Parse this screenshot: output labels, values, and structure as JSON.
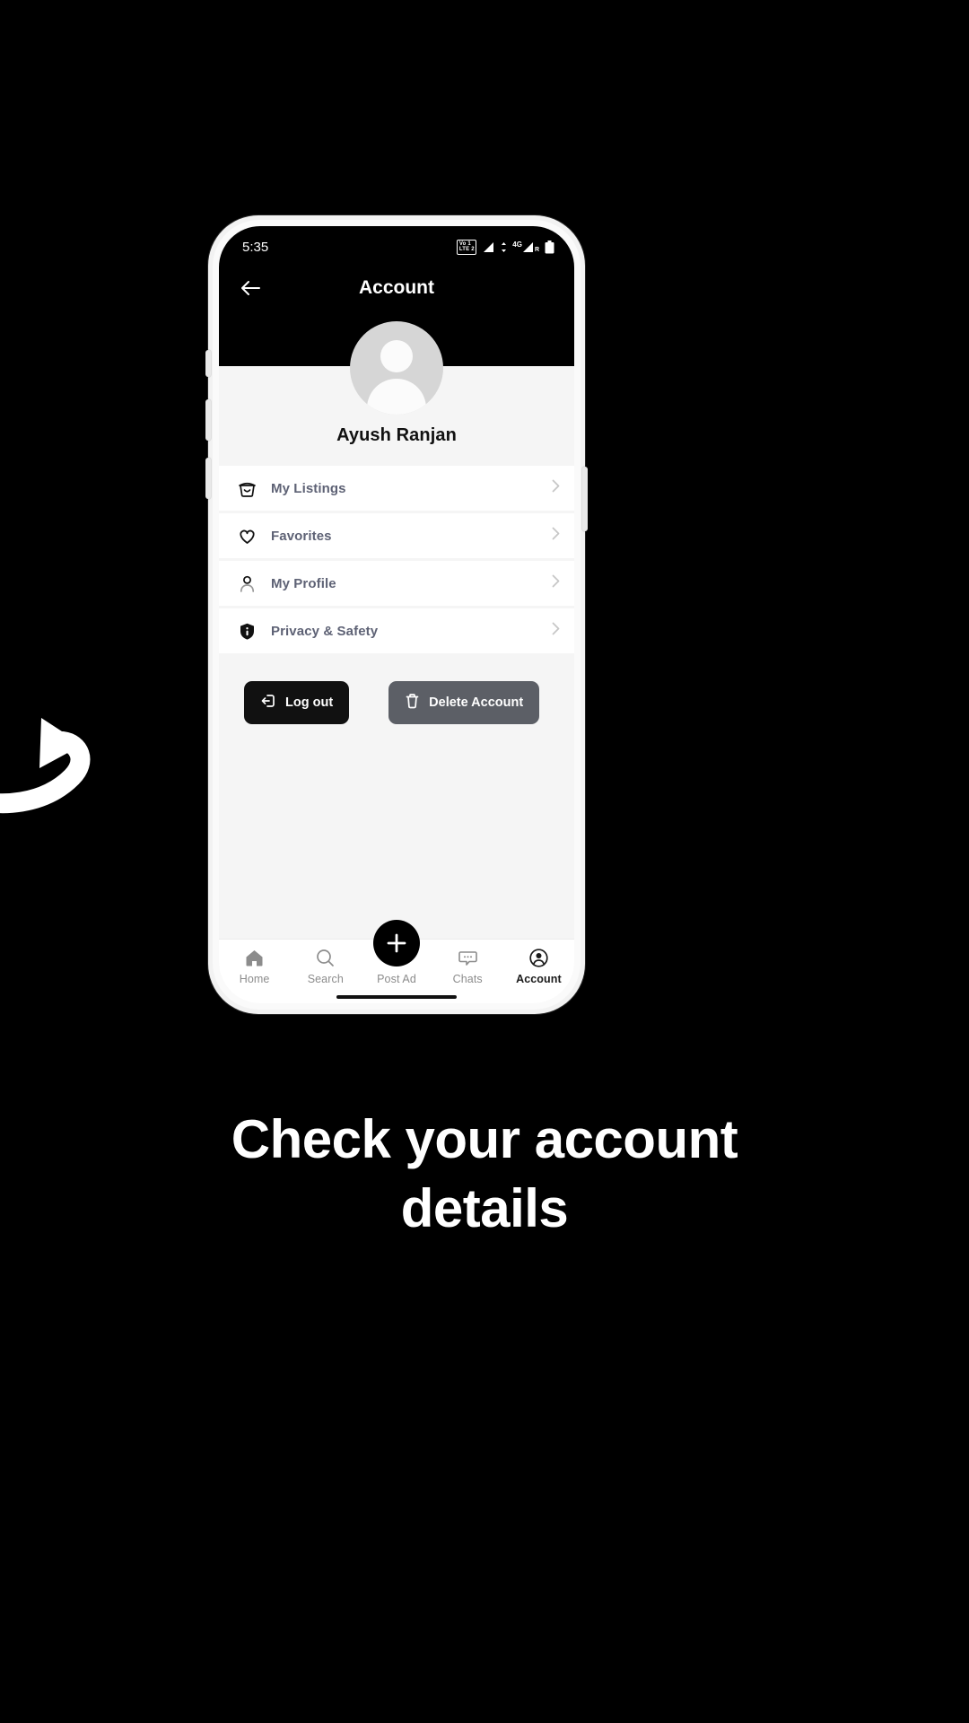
{
  "promo": {
    "headline_line1": "Check your account",
    "headline_line2": "details",
    "background_color": "#000000",
    "arrow_icon": "curved-arrow-icon"
  },
  "phone": {
    "status_bar": {
      "time": "5:35",
      "volte_top": "Vo 1",
      "volte_bottom": "LTE 2",
      "network_type": "4G",
      "roaming": "R",
      "icons": [
        "volte-icon",
        "signal-bars-icon",
        "data-arrows-icon",
        "signal-4g-icon",
        "battery-icon"
      ]
    },
    "app_bar": {
      "back_icon": "back-arrow-icon",
      "title": "Account"
    },
    "profile": {
      "avatar_icon": "avatar-placeholder-icon",
      "name": "Ayush Ranjan"
    },
    "menu": {
      "items": [
        {
          "label": "My Listings",
          "icon": "basket-icon",
          "chevron": "chevron-right-icon"
        },
        {
          "label": "Favorites",
          "icon": "heart-icon",
          "chevron": "chevron-right-icon"
        },
        {
          "label": "My Profile",
          "icon": "person-icon",
          "chevron": "chevron-right-icon"
        },
        {
          "label": "Privacy & Safety",
          "icon": "shield-info-icon",
          "chevron": "chevron-right-icon"
        }
      ]
    },
    "actions": {
      "logout_label": "Log out",
      "logout_icon": "logout-icon",
      "logout_color": "#111111",
      "delete_label": "Delete Account",
      "delete_icon": "trash-icon",
      "delete_color": "#5c5f66"
    },
    "bottom_nav": {
      "items": [
        {
          "label": "Home",
          "icon": "home-icon",
          "active": false
        },
        {
          "label": "Search",
          "icon": "search-icon",
          "active": false
        },
        {
          "label": "Post Ad",
          "icon": "plus-icon",
          "active": false
        },
        {
          "label": "Chats",
          "icon": "chat-bubble-icon",
          "active": false
        },
        {
          "label": "Account",
          "icon": "account-circle-icon",
          "active": true
        }
      ],
      "fab_icon": "plus-icon"
    }
  }
}
